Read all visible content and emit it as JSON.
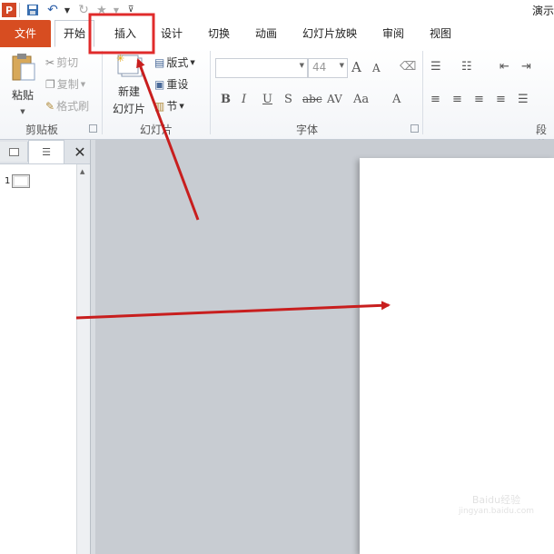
{
  "window": {
    "title": "演示"
  },
  "quick_access": {
    "icons": [
      "powerpoint-logo-icon",
      "save-icon",
      "undo-icon",
      "redo-icon",
      "star-icon",
      "customize-icon"
    ]
  },
  "tabs": [
    {
      "label": "文件"
    },
    {
      "label": "开始"
    },
    {
      "label": "插入"
    },
    {
      "label": "设计"
    },
    {
      "label": "切换"
    },
    {
      "label": "动画"
    },
    {
      "label": "幻灯片放映"
    },
    {
      "label": "审阅"
    },
    {
      "label": "视图"
    }
  ],
  "ribbon": {
    "clipboard": {
      "label": "剪贴板",
      "paste": "粘贴",
      "cut": "剪切",
      "copy": "复制",
      "format_painter": "格式刷"
    },
    "slides": {
      "label": "幻灯片",
      "new_slide_line1": "新建",
      "new_slide_line2": "幻灯片",
      "layout": "版式",
      "reset": "重设",
      "section": "节"
    },
    "font": {
      "label": "字体",
      "font_name": "",
      "font_size": "44",
      "bold": "B",
      "italic": "I",
      "underline": "U",
      "shadow": "S",
      "strike": "abc",
      "spacing": "AV",
      "case": "Aa",
      "color": "A",
      "grow": "A",
      "shrink": "A"
    },
    "paragraph": {
      "label": "段落"
    }
  },
  "left_pane": {
    "slide_number": "1"
  },
  "watermark": {
    "line1": "Baidu经验",
    "line2": "jingyan.baidu.com"
  },
  "colors": {
    "file_tab": "#d74d21",
    "highlight": "#e02b2b",
    "arrow": "#c81e1e"
  }
}
